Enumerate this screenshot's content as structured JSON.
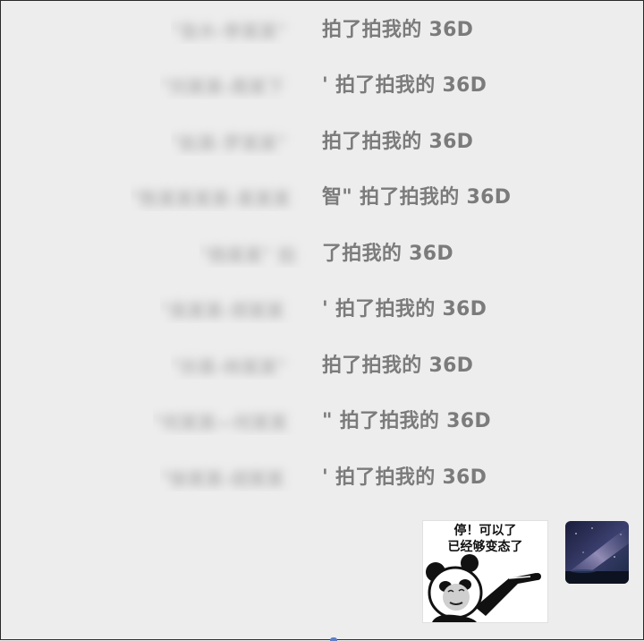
{
  "messages": [
    {
      "hidden": "\"张木-李某某\"",
      "visible": "拍了拍我的 36D"
    },
    {
      "hidden": "\"刘某某-周某下",
      "visible": "' 拍了拍我的 36D"
    },
    {
      "hidden": "\"赵某-罗某某\"",
      "visible": "拍了拍我的 36D"
    },
    {
      "hidden": "\"陈某某某某-某某某",
      "visible": "智\" 拍了拍我的 36D"
    },
    {
      "hidden": "\"杨某某\" 拍",
      "visible": "了拍我的 36D"
    },
    {
      "hidden": "\"吴某某-郑某某",
      "visible": "' 拍了拍我的 36D"
    },
    {
      "hidden": "\"孙某-林某某\"",
      "visible": "拍了拍我的 36D"
    },
    {
      "hidden": "\"何某某—何某某",
      "visible": "\" 拍了拍我的 36D"
    },
    {
      "hidden": "\"徐某某-胡某某",
      "visible": "' 拍了拍我的 36D"
    }
  ],
  "sticker": {
    "line1": "停！可以了",
    "line2": "已经够变态了"
  },
  "avatar": {
    "icon": "starry-night-avatar-icon"
  },
  "colors": {
    "background": "#ededed",
    "text": "#7b7b7b"
  }
}
